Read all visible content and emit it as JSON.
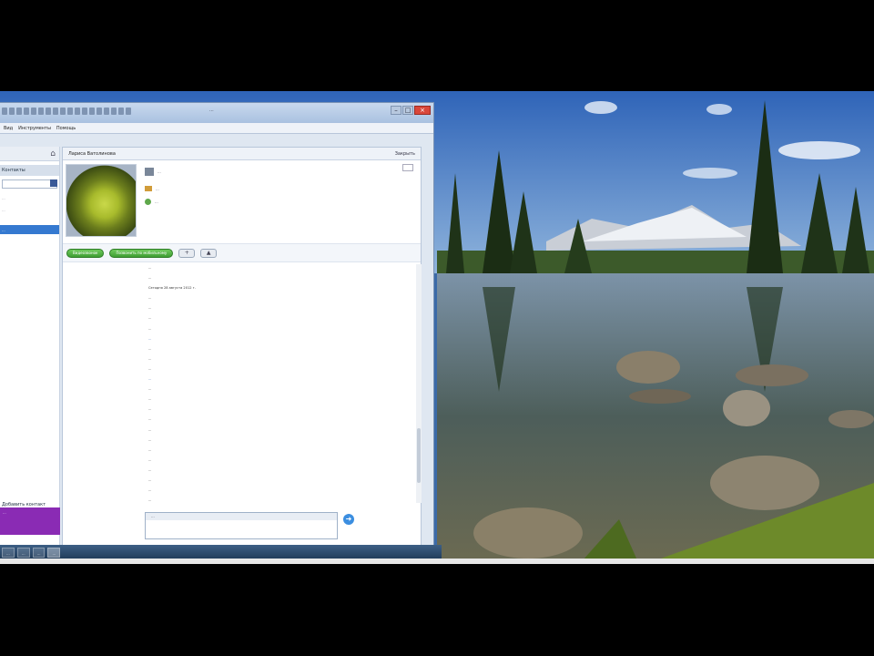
{
  "window": {
    "title_text": "...",
    "menu": [
      "Вид",
      "Инструменты",
      "Помощь"
    ]
  },
  "sidebar": {
    "tab_label": "Контакты",
    "line1": "...",
    "line2": "...",
    "selected_label": "...",
    "foot_label": "Добавить контакт",
    "promo_text": "..."
  },
  "chat": {
    "contact_name": "Лариса Ватолинова",
    "close_label": "Закрыть",
    "profile_lines": [
      "...",
      "...",
      "..."
    ],
    "actions": [
      "Видеозвонок",
      "Позвонить по мобильному"
    ],
    "messages": [
      {
        "who": "",
        "text": "...",
        "time": "",
        "style": "them"
      },
      {
        "who": "",
        "text": "...",
        "time": "",
        "style": "them"
      },
      {
        "who": "",
        "text": "Сегодня 28 августа 2012 г.",
        "time": "",
        "style": "them"
      },
      {
        "who": "",
        "text": "...",
        "time": "",
        "style": "them"
      },
      {
        "who": "",
        "text": "...",
        "time": "",
        "style": "me"
      },
      {
        "who": "",
        "text": "...",
        "time": "",
        "style": "them"
      },
      {
        "who": "",
        "text": "...",
        "time": "",
        "style": "me"
      },
      {
        "who": "",
        "text": "...",
        "time": "",
        "style": "link"
      },
      {
        "who": "",
        "text": "...",
        "time": "",
        "style": "them"
      },
      {
        "who": "",
        "text": "...",
        "time": "",
        "style": "me"
      },
      {
        "who": "",
        "text": "...",
        "time": "",
        "style": "them"
      },
      {
        "who": "",
        "text": "...",
        "time": "",
        "style": "link"
      },
      {
        "who": "",
        "text": "...",
        "time": "",
        "style": "them"
      },
      {
        "who": "",
        "text": "...",
        "time": "",
        "style": "them"
      },
      {
        "who": "",
        "text": "...",
        "time": "",
        "style": "me"
      },
      {
        "who": "",
        "text": "...",
        "time": "",
        "style": "them"
      },
      {
        "who": "",
        "text": "...",
        "time": "",
        "style": "me"
      },
      {
        "who": "",
        "text": "...",
        "time": "",
        "style": "them"
      },
      {
        "who": "",
        "text": "...",
        "time": "",
        "style": "me"
      },
      {
        "who": "",
        "text": "...",
        "time": "",
        "style": "them"
      },
      {
        "who": "",
        "text": "...",
        "time": "",
        "style": "me"
      },
      {
        "who": "",
        "text": "...",
        "time": "",
        "style": "them"
      },
      {
        "who": "",
        "text": "...",
        "time": "",
        "style": "me"
      },
      {
        "who": "",
        "text": "...",
        "time": "",
        "style": "them"
      }
    ],
    "compose_label": "...",
    "compose_text": ""
  },
  "taskbar": {
    "buttons": [
      "...",
      "...",
      "...",
      "..."
    ]
  },
  "colors": {
    "accent": "#3579d0",
    "call_green": "#3f9e33",
    "promo_purple": "#8a2bb4",
    "close_red": "#d9473a"
  }
}
